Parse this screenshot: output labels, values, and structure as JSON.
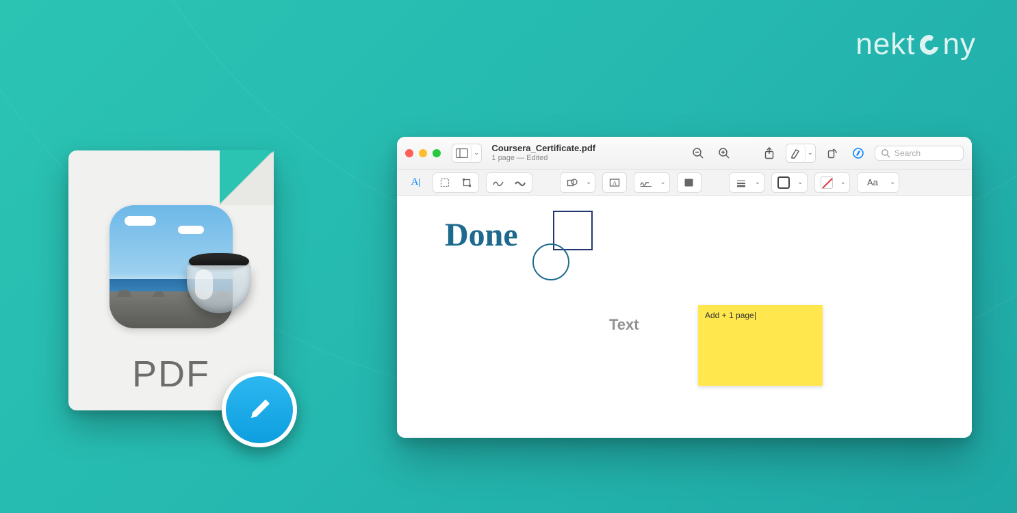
{
  "brand": "nektony",
  "pdf_icon": {
    "label": "PDF"
  },
  "window": {
    "title": "Coursera_Certificate.pdf",
    "subtitle": "1 page — Edited",
    "search_placeholder": "Search"
  },
  "canvas": {
    "handwriting": "Done",
    "text_label": "Text",
    "sticky_note": "Add + 1 page"
  },
  "markup": {
    "font_label": "Aa",
    "text_tool_label": "A"
  },
  "colors": {
    "accent": "#0a84ff",
    "annotation": "#1e6a8e",
    "square": "#23376f",
    "sticky": "#ffe74d"
  }
}
